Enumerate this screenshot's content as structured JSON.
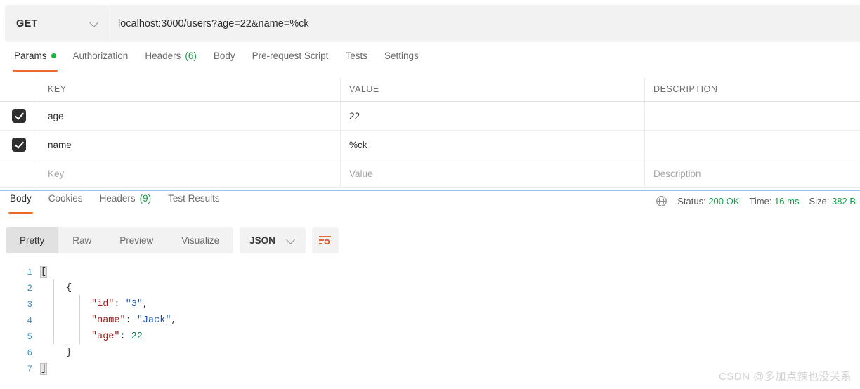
{
  "request": {
    "method": "GET",
    "url": "localhost:3000/users?age=22&name=%ck",
    "tabs": [
      {
        "label": "Params",
        "badge": "dot",
        "active": true
      },
      {
        "label": "Authorization",
        "badge": "",
        "active": false
      },
      {
        "label": "Headers",
        "badge": "(6)",
        "active": false
      },
      {
        "label": "Body",
        "badge": "",
        "active": false
      },
      {
        "label": "Pre-request Script",
        "badge": "",
        "active": false
      },
      {
        "label": "Tests",
        "badge": "",
        "active": false
      },
      {
        "label": "Settings",
        "badge": "",
        "active": false
      }
    ],
    "params_table": {
      "headers": {
        "key": "KEY",
        "value": "VALUE",
        "description": "DESCRIPTION"
      },
      "rows": [
        {
          "checked": true,
          "key": "age",
          "value": "22",
          "description": ""
        },
        {
          "checked": true,
          "key": "name",
          "value": "%ck",
          "description": ""
        }
      ],
      "placeholder_row": {
        "key": "Key",
        "value": "Value",
        "description": "Description"
      }
    }
  },
  "response": {
    "tabs": [
      {
        "label": "Body",
        "badge": "",
        "active": true
      },
      {
        "label": "Cookies",
        "badge": "",
        "active": false
      },
      {
        "label": "Headers",
        "badge": "(9)",
        "active": false
      },
      {
        "label": "Test Results",
        "badge": "",
        "active": false
      }
    ],
    "meta": {
      "status_label": "Status:",
      "status_value": "200 OK",
      "time_label": "Time:",
      "time_value": "16 ms",
      "size_label": "Size:",
      "size_value": "382 B",
      "globe_icon": "globe-icon"
    },
    "format_tabs": [
      {
        "label": "Pretty",
        "active": true
      },
      {
        "label": "Raw",
        "active": false
      },
      {
        "label": "Preview",
        "active": false
      },
      {
        "label": "Visualize",
        "active": false
      }
    ],
    "language": "JSON",
    "wrap_icon": "word-wrap-icon",
    "body_lines": [
      {
        "n": "1",
        "indent": 0,
        "tokens": [
          {
            "t": "[",
            "c": "brk"
          }
        ]
      },
      {
        "n": "2",
        "indent": 1,
        "tokens": [
          {
            "t": "{",
            "c": "pun"
          }
        ]
      },
      {
        "n": "3",
        "indent": 2,
        "tokens": [
          {
            "t": "\"id\"",
            "c": "key"
          },
          {
            "t": ": ",
            "c": "pun"
          },
          {
            "t": "\"3\"",
            "c": "str"
          },
          {
            "t": ",",
            "c": "pun"
          }
        ]
      },
      {
        "n": "4",
        "indent": 2,
        "tokens": [
          {
            "t": "\"name\"",
            "c": "key"
          },
          {
            "t": ": ",
            "c": "pun"
          },
          {
            "t": "\"Jack\"",
            "c": "str"
          },
          {
            "t": ",",
            "c": "pun"
          }
        ]
      },
      {
        "n": "5",
        "indent": 2,
        "tokens": [
          {
            "t": "\"age\"",
            "c": "key"
          },
          {
            "t": ": ",
            "c": "pun"
          },
          {
            "t": "22",
            "c": "num"
          }
        ]
      },
      {
        "n": "6",
        "indent": 1,
        "tokens": [
          {
            "t": "}",
            "c": "pun"
          }
        ]
      },
      {
        "n": "7",
        "indent": 0,
        "tokens": [
          {
            "t": "]",
            "c": "brk"
          }
        ]
      }
    ]
  },
  "watermark": "CSDN @多加点辣也没关系",
  "colors": {
    "accent_orange": "#f2682a",
    "green": "#11a14a",
    "divider_blue": "#4a90d9",
    "key_red": "#a11f1f",
    "string_blue": "#1a55b5",
    "number_green": "#0a8050"
  }
}
